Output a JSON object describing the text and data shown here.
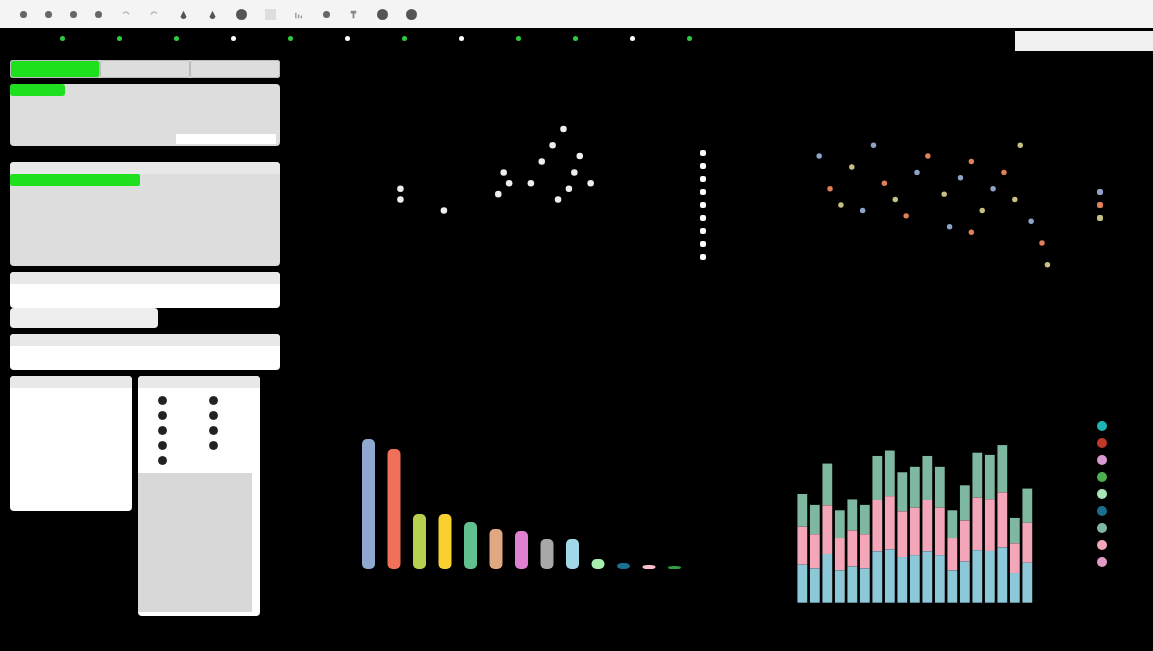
{
  "toolbar": {
    "tools": [
      {
        "kind": "dot"
      },
      {
        "kind": "dot"
      },
      {
        "kind": "dot"
      },
      {
        "kind": "dot"
      },
      {
        "kind": "undo"
      },
      {
        "kind": "redo"
      },
      {
        "kind": "drop"
      },
      {
        "kind": "drop"
      },
      {
        "kind": "circle"
      },
      {
        "kind": "square"
      },
      {
        "kind": "chart"
      },
      {
        "kind": "dot"
      },
      {
        "kind": "pin"
      },
      {
        "kind": "circle"
      },
      {
        "kind": "circle"
      }
    ]
  },
  "tab_strip": {
    "dots": [
      {
        "color": "#2ecc40"
      },
      {
        "color": "#2ecc40"
      },
      {
        "color": "#2ecc40"
      },
      {
        "color": "#ffffff"
      },
      {
        "color": "#2ecc40"
      },
      {
        "color": "#ffffff"
      },
      {
        "color": "#2ecc40"
      },
      {
        "color": "#ffffff"
      },
      {
        "color": "#2ecc40"
      },
      {
        "color": "#2ecc40"
      },
      {
        "color": "#ffffff"
      },
      {
        "color": "#2ecc40"
      }
    ]
  },
  "sidebar": {
    "tabs": [
      {
        "selected": true
      },
      {
        "selected": false
      },
      {
        "selected": false
      }
    ],
    "chip": {
      "selected": true
    },
    "list_item": {
      "selected": true
    },
    "options": [
      {
        "selected": true
      },
      {
        "selected": true
      },
      {
        "selected": true
      },
      {
        "selected": true
      },
      {
        "selected": true
      },
      {
        "selected": true
      },
      {
        "selected": true
      },
      {
        "selected": true
      },
      {
        "selected": true
      }
    ]
  },
  "scatter_legend": [
    {
      "color": "#ffffff"
    },
    {
      "color": "#ffffff"
    },
    {
      "color": "#ffffff"
    },
    {
      "color": "#ffffff"
    },
    {
      "color": "#ffffff"
    },
    {
      "color": "#ffffff"
    },
    {
      "color": "#ffffff"
    },
    {
      "color": "#ffffff"
    },
    {
      "color": "#ffffff"
    }
  ],
  "scatter2_legend": [
    {
      "color": "#8fa3c8"
    },
    {
      "color": "#e0805a"
    },
    {
      "color": "#c8c080"
    }
  ],
  "stacked_legend": [
    {
      "color": "#1fb5b5"
    },
    {
      "color": "#c0392b"
    },
    {
      "color": "#d89ad0"
    },
    {
      "color": "#4caf50"
    },
    {
      "color": "#a8e6b8"
    },
    {
      "color": "#1a6e8e"
    },
    {
      "color": "#7fb8a0"
    },
    {
      "color": "#f3a6b8"
    },
    {
      "color": "#e09ac8"
    }
  ]
}
